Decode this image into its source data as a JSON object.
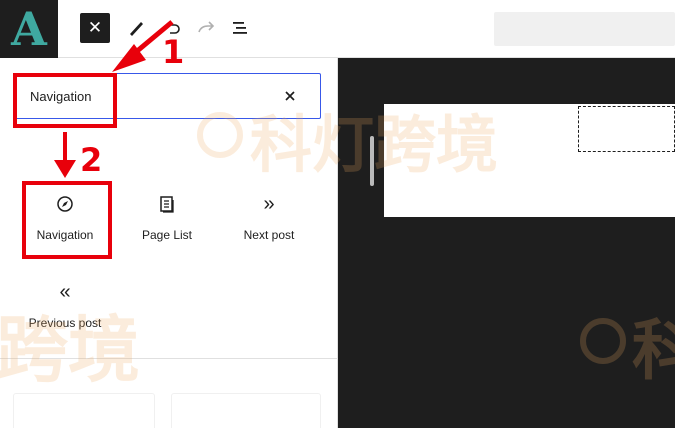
{
  "app": {
    "logo_letter": "A"
  },
  "toolbar": {
    "close_glyph": "✕",
    "icons": [
      "close-icon",
      "pen-icon",
      "undo-icon",
      "redo-icon",
      "list-view-icon"
    ]
  },
  "inserter": {
    "search_value": "Navigation",
    "clear_glyph": "✕",
    "blocks": [
      {
        "label": "Navigation",
        "icon": "navigation-compass-icon",
        "glyph": "⊘"
      },
      {
        "label": "Page List",
        "icon": "page-list-icon",
        "glyph": ""
      },
      {
        "label": "Next post",
        "icon": "next-post-icon",
        "glyph": "»"
      },
      {
        "label": "Previous post",
        "icon": "previous-post-icon",
        "glyph": "«"
      }
    ]
  },
  "annotations": {
    "step1": "1",
    "step2": "2",
    "color": "#e8000b"
  },
  "watermark": {
    "text_full": "科灯跨境",
    "text_left": "跨境",
    "text_right": "科"
  },
  "colors": {
    "accent": "#3858e9",
    "canvas_bg": "#1e1e1e",
    "logo_bg": "#1e1e1e",
    "logo_fg": "#3fa9a0"
  }
}
